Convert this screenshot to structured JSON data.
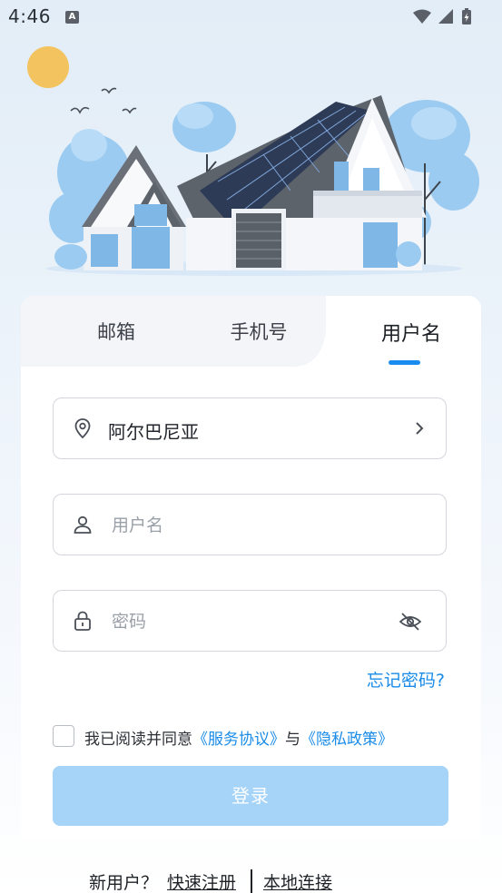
{
  "status_bar": {
    "time": "4:46",
    "notification_icon": "a-icon",
    "icons": [
      "wifi-icon",
      "signal-icon",
      "battery-charging-icon"
    ]
  },
  "tabs": [
    {
      "label": "邮箱",
      "active": false
    },
    {
      "label": "手机号",
      "active": false
    },
    {
      "label": "用户名",
      "active": true
    }
  ],
  "form": {
    "country": {
      "icon": "location-pin-icon",
      "value": "阿尔巴尼亚",
      "trailing_icon": "chevron-right-icon"
    },
    "username": {
      "icon": "user-icon",
      "placeholder": "用户名",
      "value": ""
    },
    "password": {
      "icon": "lock-icon",
      "placeholder": "密码",
      "value": "",
      "trailing_icon": "eye-closed-icon"
    },
    "forgot_password": "忘记密码?",
    "agreement": {
      "checked": false,
      "prefix": "我已阅读并同意",
      "terms_link": "《服务协议》",
      "conjunction": "与",
      "privacy_link": "《隐私政策》"
    },
    "login_button": "登录"
  },
  "footer": {
    "new_user": "新用户？",
    "register_link": "快速注册",
    "local_link": "本地连接"
  },
  "colors": {
    "accent": "#1a8cf0",
    "link": "#1a8ce8",
    "button_disabled": "#a6d3f8",
    "border": "#d3d6dc"
  }
}
